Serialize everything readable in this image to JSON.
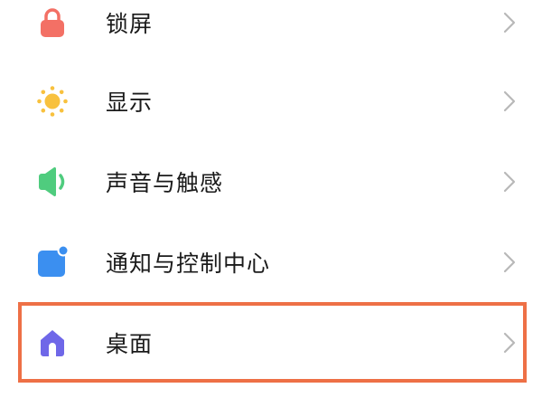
{
  "settings": {
    "items": [
      {
        "label": "锁屏",
        "icon": "lock-icon",
        "icon_color": "#f37065"
      },
      {
        "label": "显示",
        "icon": "sun-icon",
        "icon_color": "#f8c13e"
      },
      {
        "label": "声音与触感",
        "icon": "speaker-icon",
        "icon_color": "#4fcc7e"
      },
      {
        "label": "通知与控制中心",
        "icon": "notification-icon",
        "icon_color": "#3b8ff0"
      },
      {
        "label": "桌面",
        "icon": "home-icon",
        "icon_color": "#6f67e8"
      }
    ],
    "highlighted_item": "桌面",
    "highlight_color": "#ee7046",
    "chevron_icon": "chevron-right-icon",
    "chevron_color": "#b8b8b8"
  }
}
